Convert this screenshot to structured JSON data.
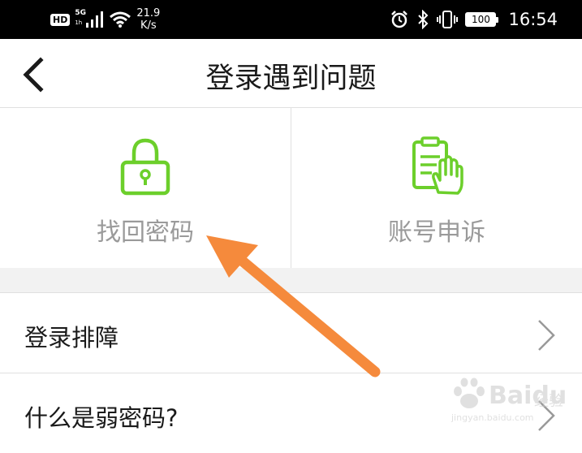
{
  "status_bar": {
    "hd": "HD",
    "network": "5G",
    "network_sub": "1h",
    "speed_value": "21.9",
    "speed_unit": "K/s",
    "battery": "100",
    "time": "16:54"
  },
  "header": {
    "title": "登录遇到问题"
  },
  "options": [
    {
      "label": "找回密码",
      "icon": "lock-icon"
    },
    {
      "label": "账号申诉",
      "icon": "clipboard-hand-icon"
    }
  ],
  "list": [
    {
      "label": "登录排障"
    },
    {
      "label": "什么是弱密码?"
    }
  ],
  "watermark": {
    "brand": "Bai",
    "brand2": "du",
    "suffix": "经验",
    "url": "jingyan.baidu.com"
  },
  "colors": {
    "accent_green": "#6ccf2b",
    "annotation_arrow": "#f58a3c"
  }
}
